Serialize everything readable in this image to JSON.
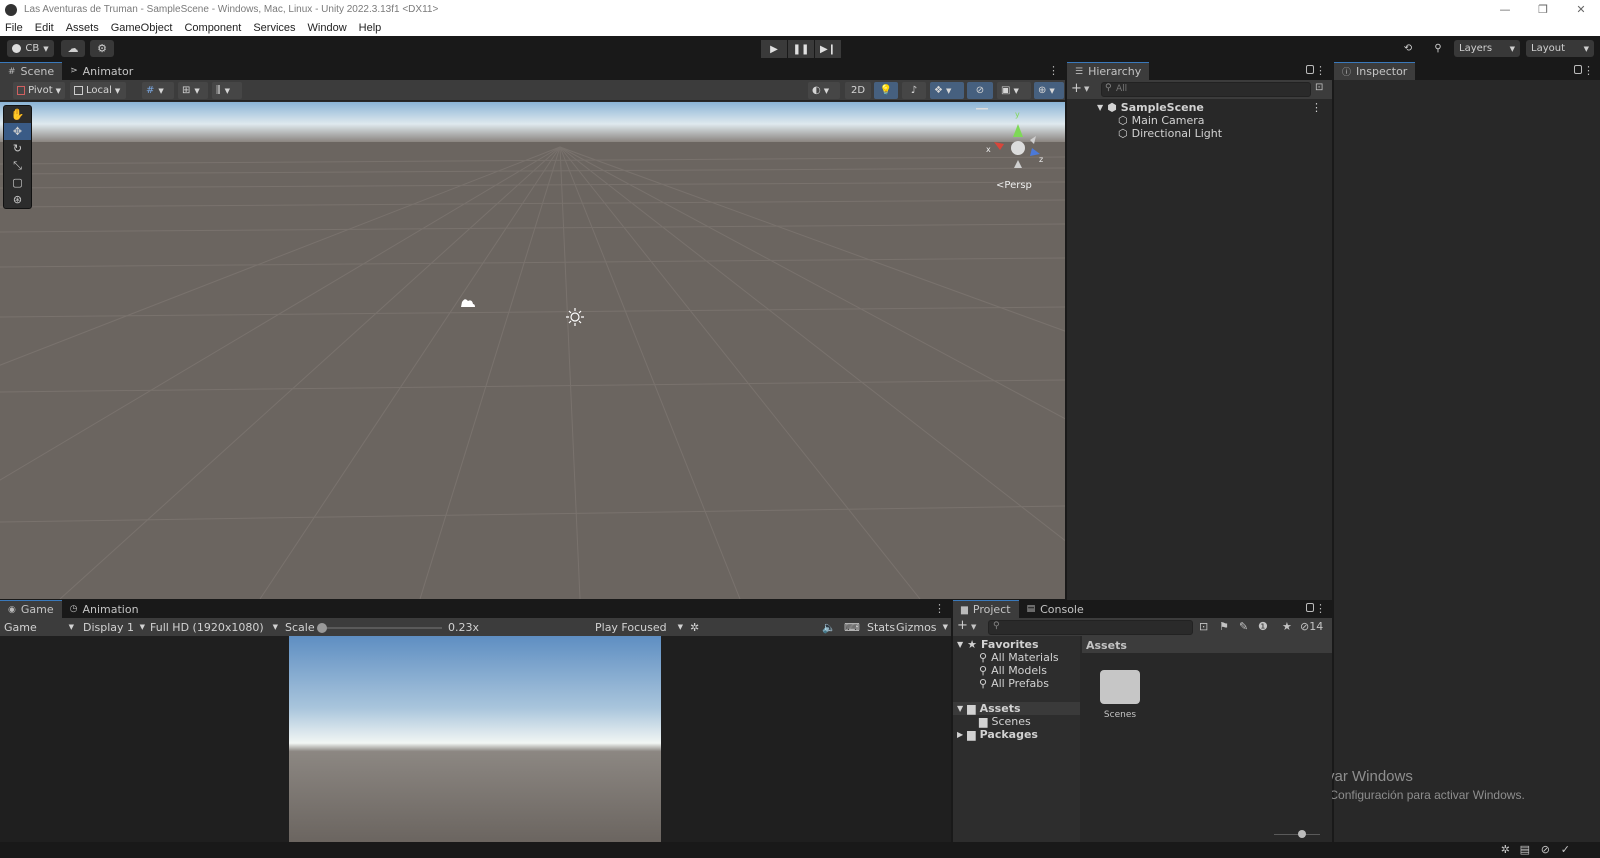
{
  "window": {
    "title": "Las Aventuras de Truman - SampleScene - Windows, Mac, Linux - Unity 2022.3.13f1 <DX11>",
    "controls": [
      "—",
      "❐",
      "✕"
    ]
  },
  "menu": [
    "File",
    "Edit",
    "Assets",
    "GameObject",
    "Component",
    "Services",
    "Window",
    "Help"
  ],
  "toolbar": {
    "account": "CB",
    "layers": "Layers",
    "layout": "Layout"
  },
  "scene_panel": {
    "tabs": [
      "Scene",
      "Animator"
    ],
    "pivot": "Pivot",
    "local": "Local",
    "mode_2d": "2D",
    "persp": "Persp",
    "gizmo_axes": {
      "x": "x",
      "y": "y",
      "z": "z"
    }
  },
  "hierarchy": {
    "tab": "Hierarchy",
    "search_placeholder": "All",
    "scene": "SampleScene",
    "items": [
      "Main Camera",
      "Directional Light"
    ]
  },
  "inspector": {
    "tab": "Inspector"
  },
  "game_panel": {
    "tabs": [
      "Game",
      "Animation"
    ],
    "view": "Game",
    "display": "Display 1",
    "resolution": "Full HD (1920x1080)",
    "scale_label": "Scale",
    "scale_value": "0.23x",
    "scale_level": 0.02,
    "play_mode": "Play Focused",
    "stats": "Stats",
    "gizmos": "Gizmos"
  },
  "project_panel": {
    "tabs": [
      "Project",
      "Console"
    ],
    "hidden_count": "14",
    "favorites_label": "Favorites",
    "favorites": [
      "All Materials",
      "All Models",
      "All Prefabs"
    ],
    "assets_label": "Assets",
    "assets_children": [
      "Scenes"
    ],
    "packages_label": "Packages",
    "breadcrumb": "Assets",
    "grid_items": [
      "Scenes"
    ]
  },
  "watermark": {
    "title": "Activar Windows",
    "subtitle": "Ve a Configuración para activar Windows."
  }
}
